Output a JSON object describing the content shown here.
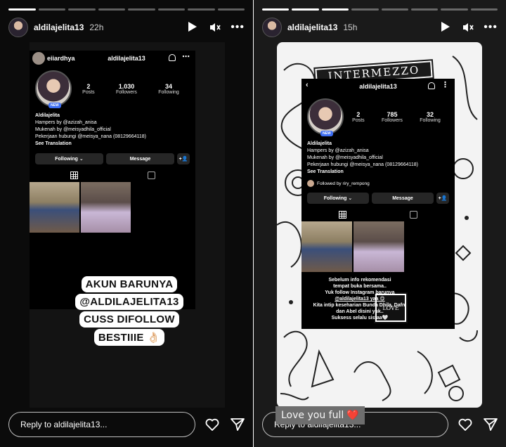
{
  "left_story": {
    "username": "aldilajelita13",
    "time": "22h",
    "reply_placeholder": "Reply to aldilajelita13...",
    "reposter_tag": "eiiardhya",
    "profile": {
      "username": "aldilajelita13",
      "posts": "2",
      "posts_label": "Posts",
      "followers": "1.030",
      "followers_label": "Followers",
      "following": "34",
      "following_label": "Following",
      "new_badge": "NEW",
      "name": "Aldilajelita",
      "bio_line1": "Hampers by @azizah_anisa",
      "bio_line2": "Mukenah by @meisyadhila_official",
      "bio_line3": "Pekerjaan hubungi @meisya_nana (08129664118)",
      "see_translation": "See Translation",
      "following_btn": "Following",
      "message_btn": "Message"
    },
    "sticker_lines": [
      "AKUN BARUNYA",
      "@ALDILAJELITA13",
      "CUSS DIFOLLOW",
      "BESTIIIE 👌🏻"
    ]
  },
  "right_story": {
    "username": "aldilajelita13",
    "time": "15h",
    "reply_placeholder": "Reply to aldilajelita13...",
    "banner": "INTERMEZZO",
    "profile": {
      "username": "aldilajelita13",
      "posts": "2",
      "posts_label": "Posts",
      "followers": "785",
      "followers_label": "Followers",
      "following": "32",
      "following_label": "Following",
      "new_badge": "NEW",
      "name": "Aldilajelita",
      "bio_line1": "Hampers by @azizah_anisa",
      "bio_line2": "Mukenah by @meisyadhila_official",
      "bio_line3": "Pekerjaan hubungi @meisya_nana (08129664118)",
      "see_translation": "See Translation",
      "followed_by": "Followed by riry_rempong",
      "following_btn": "Following",
      "message_btn": "Message"
    },
    "caption_lines": [
      "Sebelum info rekomendasi",
      "tempat buka bersama..",
      "Yuk follow Instagram barunya",
      "@aldilajelita13 yaa 😋",
      "Kita intip keseharian Bunda Dhila, Dafni",
      "dan Abel disini yuk..",
      "Suksess selalu sistaa🤍"
    ],
    "love_frame": "LOVE",
    "love_you": "Love you full",
    "love_heart": "❤️"
  },
  "icons": {
    "play": "play-icon",
    "mute": "mute-icon",
    "more": "more-icon",
    "heart": "heart-icon",
    "send": "send-icon"
  },
  "colors": {
    "heart_red": "#e0263a",
    "badge_blue": "#3d6df2"
  }
}
